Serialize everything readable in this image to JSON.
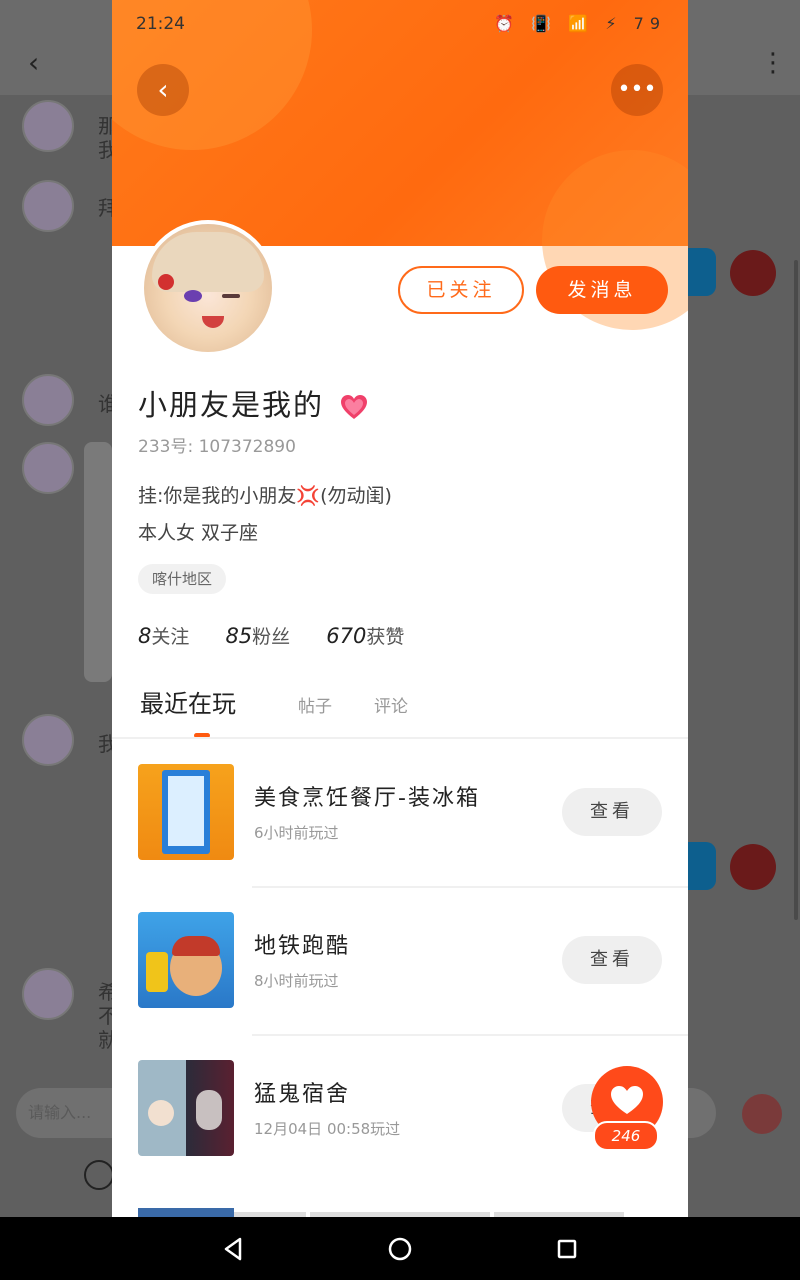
{
  "background_chat": {
    "messages_preview": [
      "那",
      "我",
      "拜",
      "谁",
      "我",
      "希",
      "不",
      "就"
    ],
    "input_placeholder": "请输入..."
  },
  "status_bar": {
    "time": "21:24",
    "battery": "79"
  },
  "profile": {
    "follow_label": "已关注",
    "message_label": "发消息",
    "name": "小朋友是我的",
    "id_label": "233号: 107372890",
    "bio_line1": "挂:你是我的小朋友",
    "bio_line1_suffix": "(勿动闺)",
    "bio_line2": "本人女 双子座",
    "region": "喀什地区",
    "stats": {
      "following_count": "8",
      "following_label": "关注",
      "fans_count": "85",
      "fans_label": "粉丝",
      "likes_count": "670",
      "likes_label": "获赞"
    }
  },
  "tabs": {
    "recent": "最近在玩",
    "posts": "帖子",
    "comments": "评论"
  },
  "games": [
    {
      "title": "美食烹饪餐厅-装冰箱",
      "sub": "6小时前玩过",
      "button": "查看"
    },
    {
      "title": "地铁跑酷",
      "sub": "8小时前玩过",
      "button": "查看"
    },
    {
      "title": "猛鬼宿舍",
      "sub": "12月04日 00:58玩过",
      "button": "查看"
    }
  ],
  "like_widget": {
    "count": "246"
  },
  "colors": {
    "accent": "#ff5a10",
    "header_orange": "#ff6f12"
  }
}
